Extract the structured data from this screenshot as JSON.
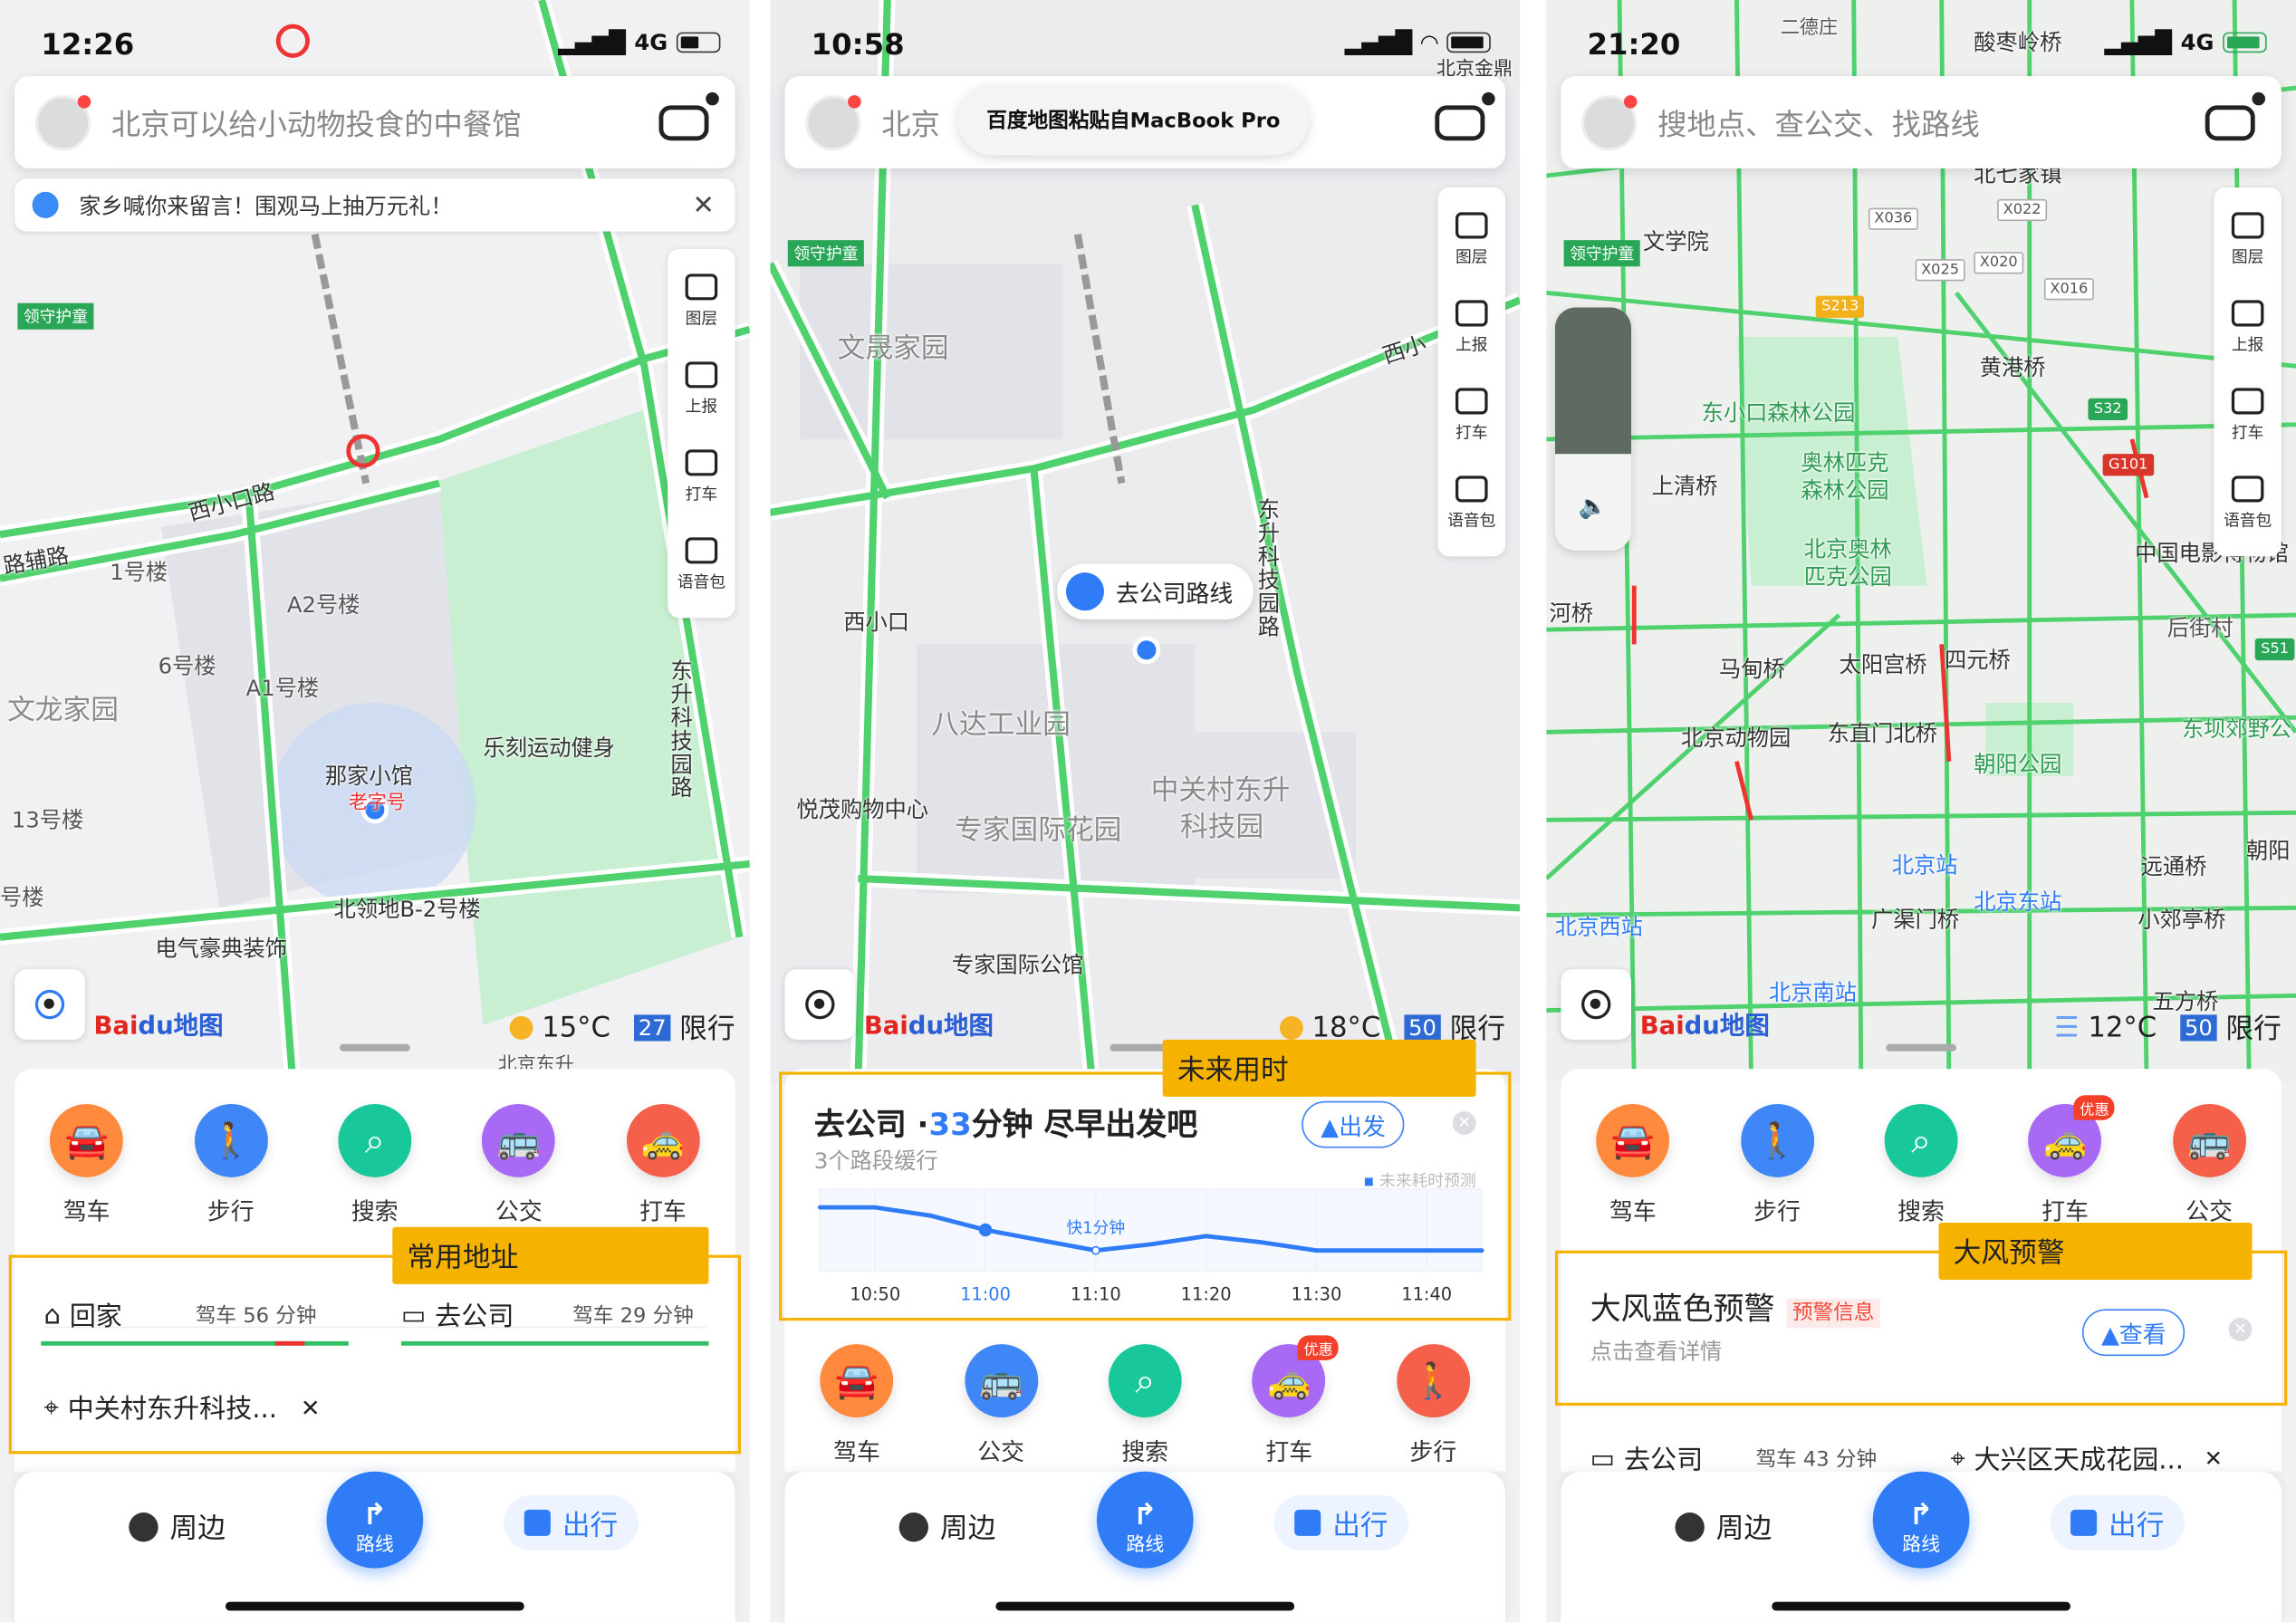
{
  "panels": [
    {
      "time": "12:26",
      "network": "4G",
      "search_placeholder": "北京可以给小动物投食的中餐馆",
      "banner": "家乡喊你来留言！围观马上抽万元礼！",
      "tools": [
        "图层",
        "上报",
        "打车",
        "语音包"
      ],
      "map_labels": [
        "西小口路",
        "路辅路",
        "1号楼",
        "A2号楼",
        "6号楼",
        "A1号楼",
        "文龙家园",
        "那家小馆",
        "老字号",
        "乐刻运动健身",
        "13号楼",
        "北领地B-2号楼",
        "号楼",
        "电气豪典装饰",
        "东升科技园路",
        "领守护童",
        "北京东升"
      ],
      "weather": {
        "temp": "15°C",
        "aqi": "27",
        "restrict": "限行"
      },
      "logo": {
        "a": "Bai",
        "b": "du地图"
      },
      "actions": [
        {
          "label": "驾车",
          "icon": "car-icon",
          "color": "#ff8a3d"
        },
        {
          "label": "步行",
          "icon": "walk-icon",
          "color": "#3f86f7"
        },
        {
          "label": "搜索",
          "icon": "search-icon",
          "color": "#18c79a"
        },
        {
          "label": "公交",
          "icon": "bus-icon",
          "color": "#a86af5"
        },
        {
          "label": "打车",
          "icon": "taxi-icon",
          "color": "#f5604a"
        }
      ],
      "highlight_tag": "常用地址",
      "home": {
        "label": "回家",
        "eta": "驾车 56 分钟"
      },
      "work": {
        "label": "去公司",
        "eta": "驾车 29 分钟"
      },
      "recent": "中关村东升科技...",
      "nav": {
        "nearby": "周边",
        "route": "路线",
        "travel": "出行"
      }
    },
    {
      "time": "10:58",
      "network": "",
      "search_placeholder": "北京",
      "toast": "百度地图粘贴自MacBook Pro",
      "tools": [
        "图层",
        "上报",
        "打车",
        "语音包"
      ],
      "map_labels": [
        "文晟家园",
        "西小口",
        "八达工业园",
        "悦茂购物中心",
        "专家国际花园",
        "中关村东升",
        "科技园",
        "专家国际公馆",
        "东升科技园路",
        "西小",
        "北京金鼎",
        "领守护童"
      ],
      "bubble": "去公司路线",
      "weather": {
        "temp": "18°C",
        "aqi": "50",
        "restrict": "限行"
      },
      "logo": {
        "a": "Bai",
        "b": "du地图"
      },
      "highlight_tag": "未来用时",
      "eta_card": {
        "prefix": "去公司 ·",
        "minutes": "33",
        "suffix": "分钟 尽早出发吧",
        "sub": "3个路段缓行",
        "go": "出发",
        "legend": "未来耗时预测",
        "annotation": "快1分钟"
      },
      "actions": [
        {
          "label": "驾车",
          "icon": "car-icon",
          "color": "#ff8a3d"
        },
        {
          "label": "公交",
          "icon": "bus-icon",
          "color": "#3f86f7"
        },
        {
          "label": "搜索",
          "icon": "search-icon",
          "color": "#18c79a"
        },
        {
          "label": "打车",
          "icon": "taxi-icon",
          "color": "#a86af5",
          "badge": "优惠"
        },
        {
          "label": "步行",
          "icon": "walk-icon",
          "color": "#f5604a"
        }
      ],
      "nav": {
        "nearby": "周边",
        "route": "路线",
        "travel": "出行"
      }
    },
    {
      "time": "21:20",
      "network": "4G",
      "search_placeholder": "搜地点、查公交、找路线",
      "tools": [
        "图层",
        "上报",
        "打车",
        "语音包"
      ],
      "map_labels": [
        "酸枣岭桥",
        "文学院",
        "黄港桥",
        "东小口森林公园",
        "奥林匹克",
        "森林公园",
        "上清桥",
        "北京奥林",
        "匹克公园",
        "中国电影博物馆",
        "后街村",
        "马甸桥",
        "太阳宫桥",
        "四元桥",
        "北京动物园",
        "东直门北桥",
        "朝阳公园",
        "东坝郊野公",
        "北京站",
        "北京东站",
        "远通桥",
        "北京西站",
        "广渠门桥",
        "小郊亭桥",
        "北京南站",
        "五方桥",
        "河桥",
        "北七家镇",
        "朝阳",
        "二德庄",
        "领守护童"
      ],
      "shields": [
        "X036",
        "X022",
        "X025",
        "X020",
        "X016",
        "S213",
        "S32",
        "G101",
        "S51"
      ],
      "weather": {
        "temp": "12°C",
        "aqi": "50",
        "restrict": "限行"
      },
      "logo": {
        "a": "Bai",
        "b": "du地图"
      },
      "actions": [
        {
          "label": "驾车",
          "icon": "car-icon",
          "color": "#ff8a3d"
        },
        {
          "label": "步行",
          "icon": "walk-icon",
          "color": "#3f86f7"
        },
        {
          "label": "搜索",
          "icon": "search-icon",
          "color": "#18c79a"
        },
        {
          "label": "打车",
          "icon": "taxi-icon",
          "color": "#a86af5",
          "badge": "优惠"
        },
        {
          "label": "公交",
          "icon": "bus-icon",
          "color": "#f5604a"
        }
      ],
      "highlight_tag": "大风预警",
      "alert": {
        "title": "大风蓝色预警",
        "badge": "预警信息",
        "sub": "点击查看详情",
        "view": "查看"
      },
      "work": {
        "label": "去公司",
        "eta": "驾车 43 分钟"
      },
      "recent": "大兴区天成花园...",
      "nav": {
        "nearby": "周边",
        "route": "路线",
        "travel": "出行"
      }
    }
  ],
  "chart_data": {
    "type": "line",
    "title": "",
    "xlabel": "",
    "ylabel": "",
    "x": [
      "10:45",
      "10:50",
      "10:55",
      "11:00",
      "11:05",
      "11:10",
      "11:15",
      "11:20",
      "11:25",
      "11:30",
      "11:35",
      "11:40",
      "11:45"
    ],
    "tick_labels": [
      "10:50",
      "11:00",
      "11:10",
      "11:20",
      "11:30",
      "11:40"
    ],
    "values": [
      34.1,
      34.1,
      33.7,
      33,
      32.5,
      32,
      32.3,
      32.7,
      32.4,
      32,
      32,
      32,
      32
    ],
    "highlight_x": "11:00",
    "annotation": {
      "x": "11:10",
      "text": "快1分钟"
    },
    "series_color": "#2f7cf6",
    "grid": true,
    "legend": "top-right"
  },
  "colors": {
    "accent": "#2f7cf6",
    "highlight": "#f5b300",
    "road": "#4fd16e"
  }
}
